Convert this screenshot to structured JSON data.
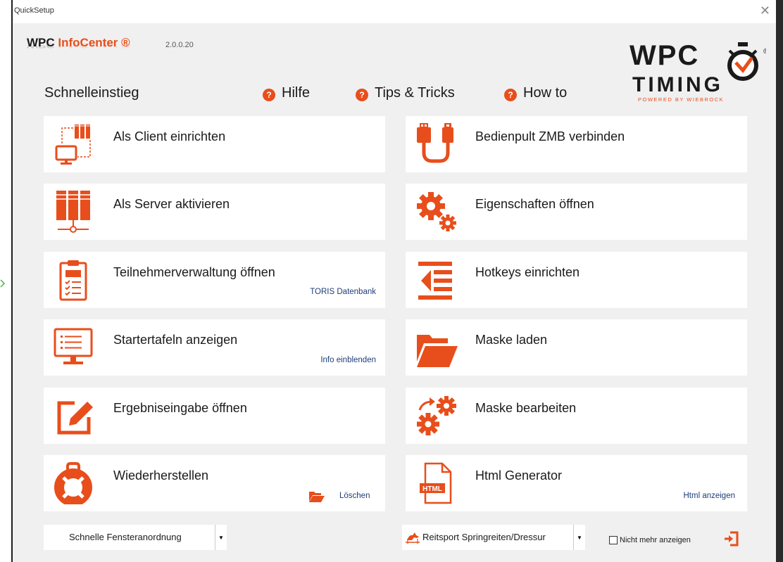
{
  "window": {
    "title": "QuickSetup",
    "close_glyph": "✕"
  },
  "brand": {
    "name_prefix": "WPC",
    "name_accent": "InfoCenter ®",
    "version": "2.0.0.20"
  },
  "logo": {
    "line1": "WPC",
    "line2": "TIMING",
    "tagline": "POWERED BY WIEBROCK",
    "registered": "®"
  },
  "heading": "Schnelleinstieg",
  "help_links": [
    {
      "label": "Hilfe",
      "icon": "question-icon"
    },
    {
      "label": "Tips & Tricks",
      "icon": "question-icon"
    },
    {
      "label": "How to",
      "icon": "question-icon"
    }
  ],
  "cards": [
    {
      "label": "Als Client einrichten",
      "icon": "client-network-icon"
    },
    {
      "label": "Bedienpult ZMB verbinden",
      "icon": "usb-cable-icon"
    },
    {
      "label": "Als Server aktivieren",
      "icon": "server-icon"
    },
    {
      "label": "Eigenschaften öffnen",
      "icon": "gears-icon"
    },
    {
      "label": "Teilnehmerverwaltung öffnen",
      "icon": "clipboard-icon",
      "sub": "TORIS Datenbank"
    },
    {
      "label": "Hotkeys einrichten",
      "icon": "indent-list-icon"
    },
    {
      "label": "Startertafeln anzeigen",
      "icon": "monitor-list-icon",
      "sub": "Info einblenden"
    },
    {
      "label": "Maske laden",
      "icon": "folder-open-icon"
    },
    {
      "label": "Ergebniseingabe öffnen",
      "icon": "edit-icon"
    },
    {
      "label": "Maske bearbeiten",
      "icon": "gear-refresh-icon"
    },
    {
      "label": "Wiederherstellen",
      "icon": "lifebuoy-icon",
      "sub": "Löschen",
      "sub_icon": "folder-icon"
    },
    {
      "label": "Html Generator",
      "icon": "html-file-icon",
      "sub": "Html anzeigen"
    }
  ],
  "footer": {
    "window_arrangement": {
      "selected": "Schnelle Fensteranordnung",
      "arrow": "▼"
    },
    "sport": {
      "selected": "Reitsport Springreiten/Dressur",
      "icon": "horse-icon",
      "arrow": "▼"
    },
    "dont_show": {
      "label": "Nicht mehr anzeigen",
      "checked": false
    },
    "exit_icon": "exit-icon"
  },
  "colors": {
    "accent": "#e84e1b",
    "link": "#1f3d7a",
    "panel": "#f0f0f0",
    "card": "#ffffff"
  }
}
